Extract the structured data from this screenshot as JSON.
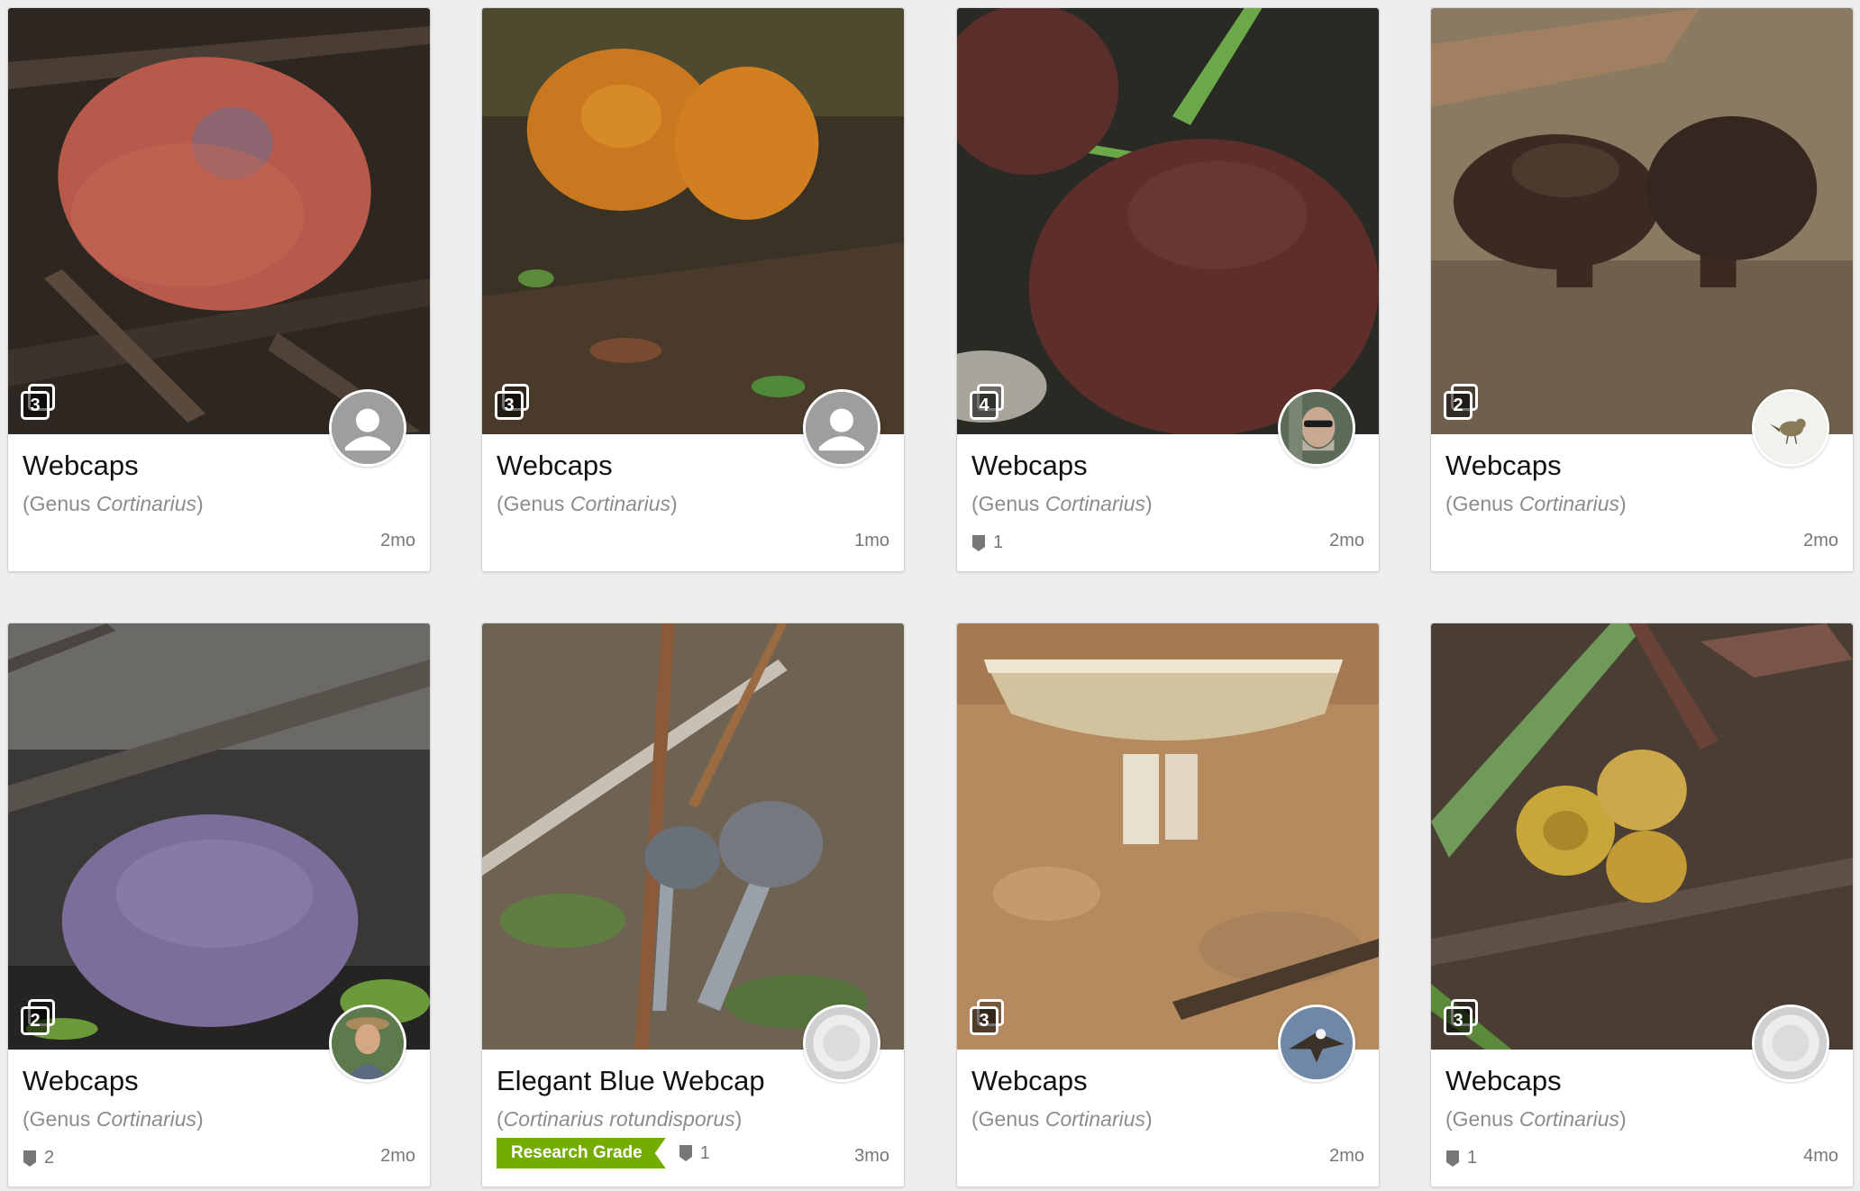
{
  "cards": [
    {
      "title": "Webcaps",
      "sub_pre": "(Genus ",
      "sub_sci": "Cortinarius",
      "sub_post": ")",
      "photo_count": "3",
      "ids_count": "",
      "research_grade": "",
      "time": "2mo",
      "avatar": "default-user-icon"
    },
    {
      "title": "Webcaps",
      "sub_pre": "(Genus ",
      "sub_sci": "Cortinarius",
      "sub_post": ")",
      "photo_count": "3",
      "ids_count": "",
      "research_grade": "",
      "time": "1mo",
      "avatar": "default-user-icon"
    },
    {
      "title": "Webcaps",
      "sub_pre": "(Genus ",
      "sub_sci": "Cortinarius",
      "sub_post": ")",
      "photo_count": "4",
      "ids_count": "1",
      "research_grade": "",
      "time": "2mo",
      "avatar": "user-photo"
    },
    {
      "title": "Webcaps",
      "sub_pre": "(Genus ",
      "sub_sci": "Cortinarius",
      "sub_post": ")",
      "photo_count": "2",
      "ids_count": "",
      "research_grade": "",
      "time": "2mo",
      "avatar": "bird-user-photo"
    },
    {
      "title": "Webcaps",
      "sub_pre": "(Genus ",
      "sub_sci": "Cortinarius",
      "sub_post": ")",
      "photo_count": "2",
      "ids_count": "2",
      "research_grade": "",
      "time": "2mo",
      "avatar": "user-photo"
    },
    {
      "title": "Elegant Blue Webcap",
      "sub_pre": "(",
      "sub_sci": "Cortinarius rotundisporus",
      "sub_post": ")",
      "photo_count": "",
      "ids_count": "1",
      "research_grade": "Research Grade",
      "time": "3mo",
      "avatar": "fungus-user-photo"
    },
    {
      "title": "Webcaps",
      "sub_pre": "(Genus ",
      "sub_sci": "Cortinarius",
      "sub_post": ")",
      "photo_count": "3",
      "ids_count": "",
      "research_grade": "",
      "time": "2mo",
      "avatar": "eagle-user-photo"
    },
    {
      "title": "Webcaps",
      "sub_pre": "(Genus ",
      "sub_sci": "Cortinarius",
      "sub_post": ")",
      "photo_count": "3",
      "ids_count": "1",
      "research_grade": "",
      "time": "4mo",
      "avatar": "fungus-user-photo"
    }
  ],
  "colors": {
    "research_grade": "#74ac00",
    "muted_text": "#8c8c8c",
    "page_bg": "#eeeeee"
  }
}
